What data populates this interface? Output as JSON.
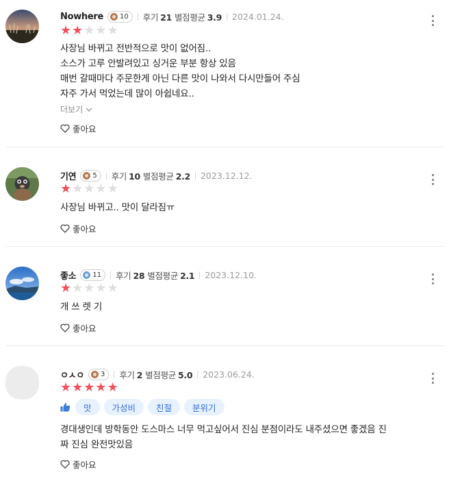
{
  "reviews": [
    {
      "author": "Nowhere",
      "level": "10",
      "review_label": "후기",
      "review_count": "21",
      "avg_label": "별점평균",
      "avg_rating": "3.9",
      "date": "2024.01.24.",
      "rating": 2,
      "text_lines": [
        "사장님 바뀌고 전반적으로 맛이 없어짐..",
        "소스가 고루 안발려있고 싱거운 부분 항상 있음",
        "매번 갈때마다 주문한게 아닌 다른 맛이 나와서 다시만들어 주심",
        "자주 가서 먹었는데 많이 아쉽네요.."
      ],
      "more_label": "더보기",
      "like_label": "좋아요"
    },
    {
      "author": "기연",
      "level": "5",
      "review_label": "후기",
      "review_count": "10",
      "avg_label": "별점평균",
      "avg_rating": "2.2",
      "date": "2023.12.12.",
      "rating": 1,
      "text_lines": [
        "사장님 바뀌고.. 맛이 달라짐ㅠ"
      ],
      "like_label": "좋아요"
    },
    {
      "author": "좋소",
      "level": "11",
      "review_label": "후기",
      "review_count": "28",
      "avg_label": "별점평균",
      "avg_rating": "2.1",
      "date": "2023.12.10.",
      "rating": 1,
      "text_lines": [
        "개 쓰 렛 기"
      ],
      "like_label": "좋아요"
    },
    {
      "author": "ㅇㅅㅇ",
      "level": "3",
      "review_label": "후기",
      "review_count": "2",
      "avg_label": "별점평균",
      "avg_rating": "5.0",
      "date": "2023.06.24.",
      "rating": 5,
      "tags": [
        "맛",
        "가성비",
        "친절",
        "분위기"
      ],
      "text_lines": [
        "경대생인데 방학동안 도스마스 너무 먹고싶어서 진심 분점이라도 내주셨으면 좋겠음 진",
        "짜 진심 완전맛있음"
      ],
      "like_label": "좋아요"
    }
  ],
  "colors": {
    "star_on": "#f0505a",
    "star_off": "#dedede",
    "tag_bg": "#e8f1fe",
    "tag_text": "#2f6fd6",
    "thumb": "#3b7ddd"
  },
  "icons": {
    "heart": "heart-outline-icon",
    "more": "chevron-down-icon",
    "menu": "kebab-menu-icon",
    "recommend": "thumbs-up-icon"
  }
}
